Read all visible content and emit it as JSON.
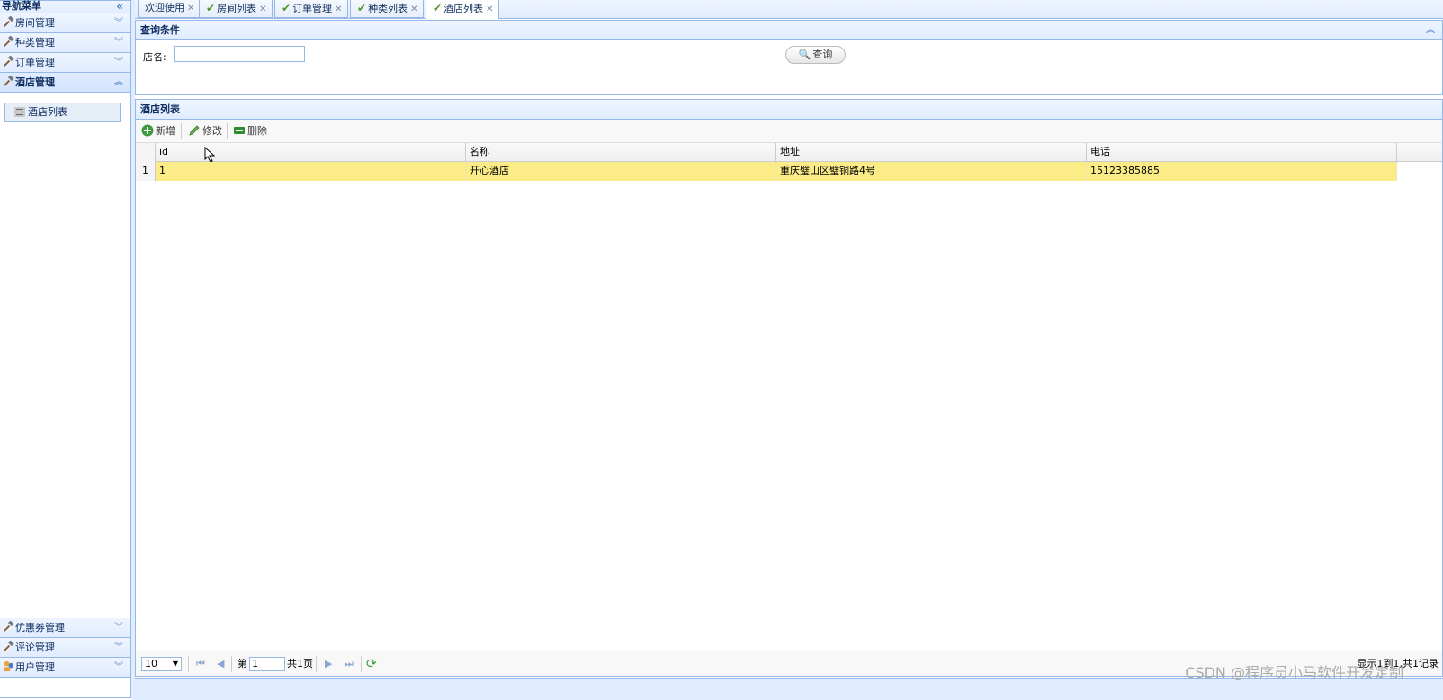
{
  "nav": {
    "title": "导航菜单",
    "sections": [
      {
        "label": "房间管理"
      },
      {
        "label": "种类管理"
      },
      {
        "label": "订单管理"
      },
      {
        "label": "酒店管理",
        "items": [
          {
            "label": "酒店列表"
          }
        ]
      }
    ],
    "bottom_sections": [
      {
        "label": "优惠券管理"
      },
      {
        "label": "评论管理"
      },
      {
        "label": "用户管理"
      }
    ]
  },
  "tabs": [
    {
      "label": "欢迎使用",
      "checked": false
    },
    {
      "label": "房间列表",
      "checked": true
    },
    {
      "label": "订单管理",
      "checked": true
    },
    {
      "label": "种类列表",
      "checked": true
    },
    {
      "label": "酒店列表",
      "checked": true,
      "selected": true
    }
  ],
  "query": {
    "title": "查询条件",
    "name_label": "店名:",
    "name_value": "",
    "search_button": "查询"
  },
  "list": {
    "title": "酒店列表",
    "toolbar": {
      "add": "新增",
      "edit": "修改",
      "delete": "删除"
    },
    "columns": [
      "id",
      "名称",
      "地址",
      "电话"
    ],
    "rows": [
      {
        "num": "1",
        "id": "1",
        "name": "开心酒店",
        "address": "重庆璧山区璧铜路4号",
        "phone": "15123385885"
      }
    ]
  },
  "pager": {
    "page_size": "10",
    "page_prefix": "第",
    "page_value": "1",
    "page_total": "共1页",
    "info": "显示1到1,共1记录"
  },
  "watermark": "CSDN @程序员小马软件开发定制",
  "colors": {
    "header_bg": "#e0ecff",
    "border": "#95b8e7",
    "row_selected": "#fbec88"
  }
}
